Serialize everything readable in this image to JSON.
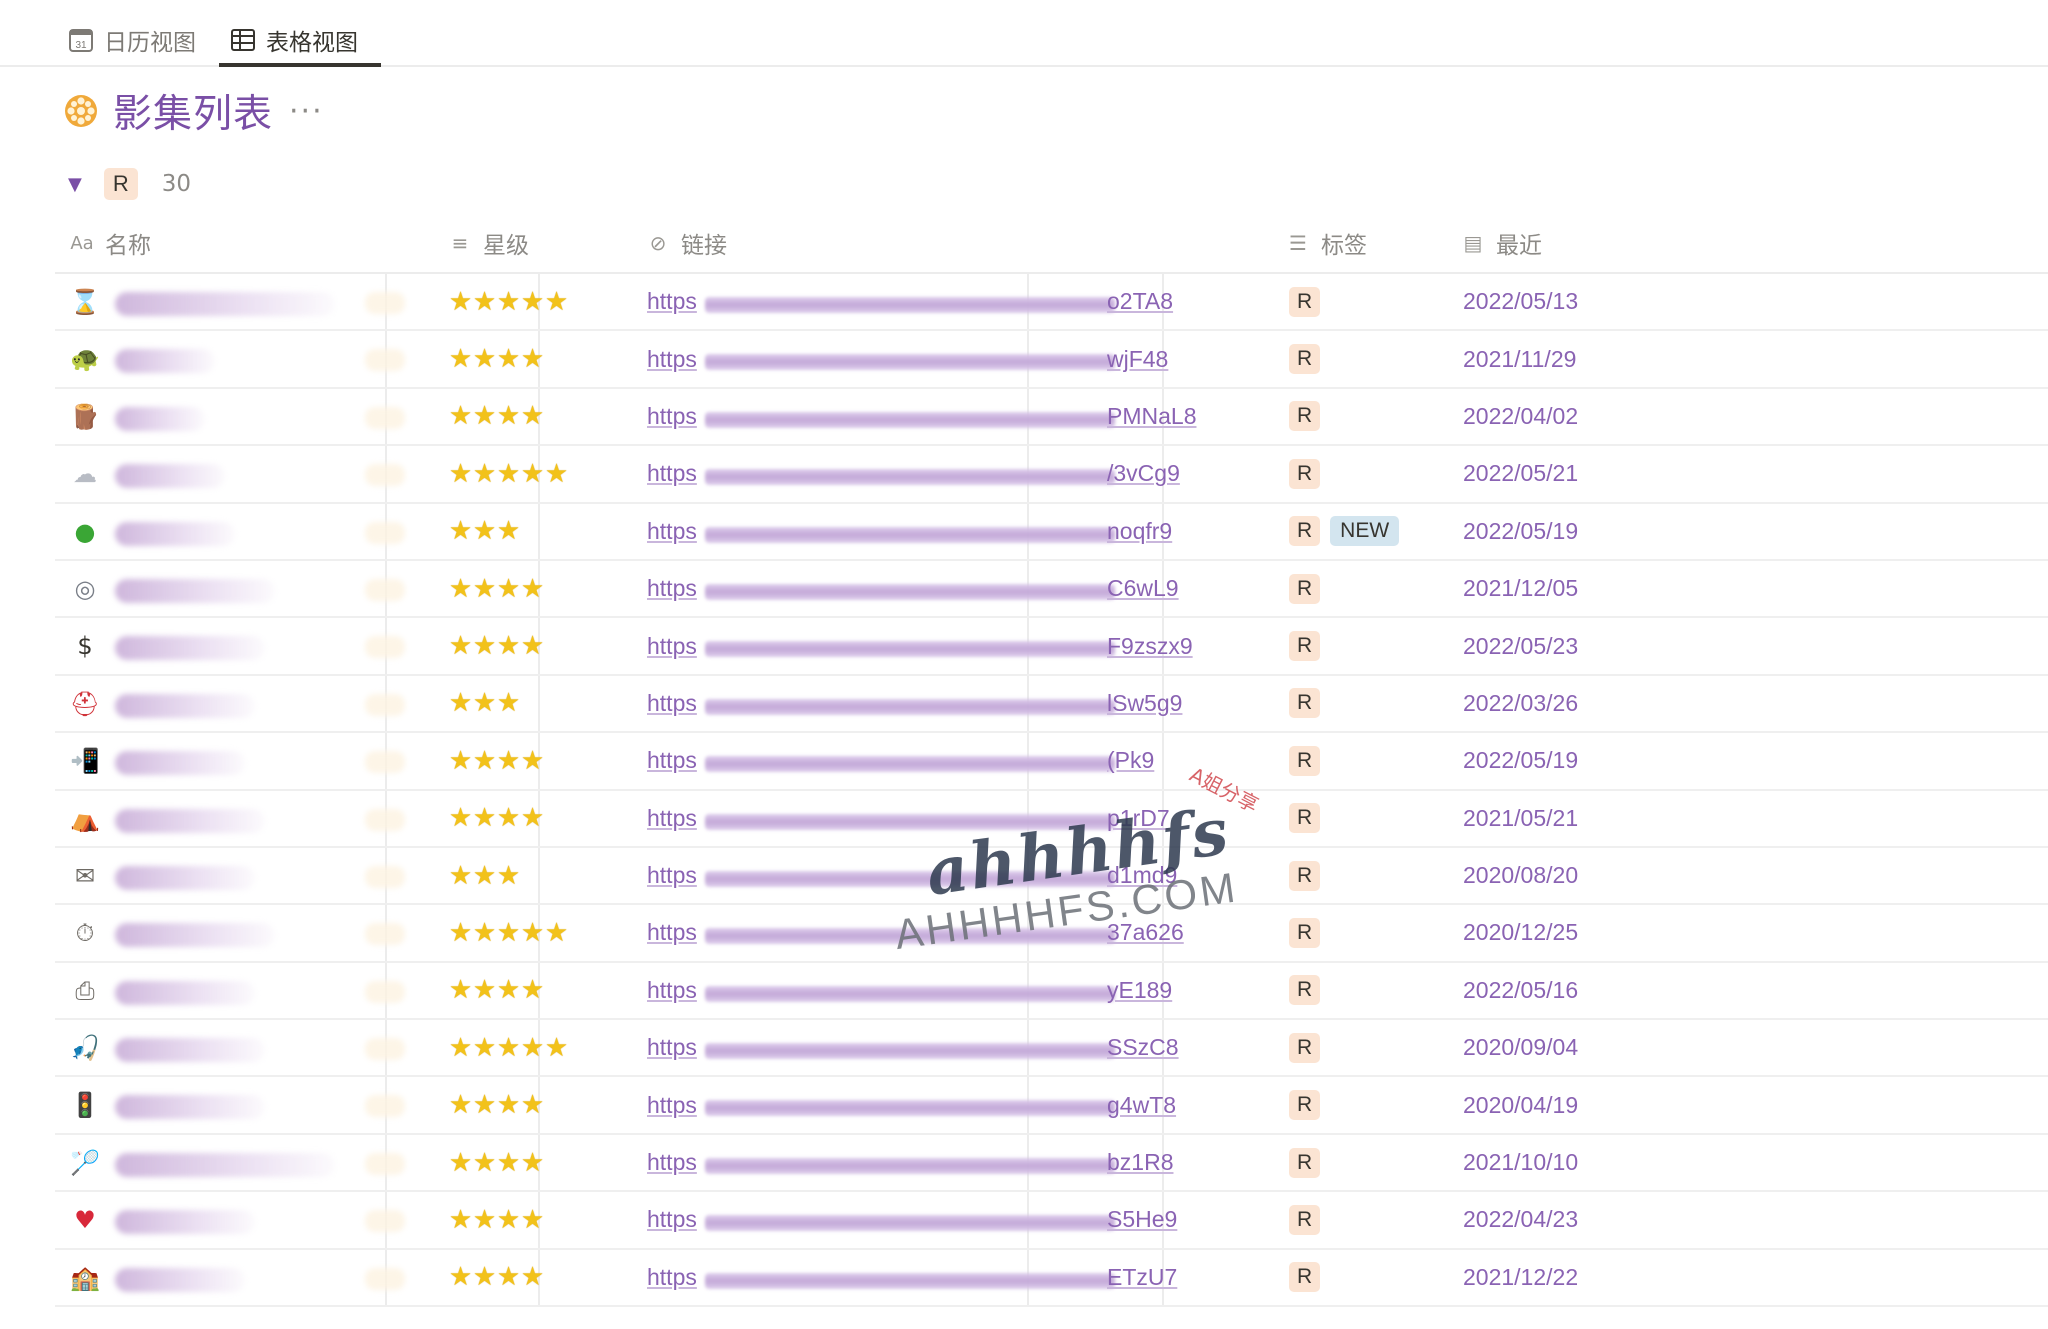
{
  "tabs": [
    {
      "label": "日历视图",
      "icon": "calendar-icon",
      "active": false
    },
    {
      "label": "表格视图",
      "icon": "table-icon",
      "active": true
    }
  ],
  "page": {
    "title": "影集列表",
    "emoji": "film-reel-icon",
    "more": "···"
  },
  "group": {
    "caret": "▼",
    "tag": "R",
    "count": "30"
  },
  "columns": {
    "name": {
      "label": "名称",
      "icon": "Aa"
    },
    "rating": {
      "label": "星级",
      "icon": "≡"
    },
    "link": {
      "label": "链接",
      "icon": "⊘"
    },
    "tags": {
      "label": "标签",
      "icon": "☰"
    },
    "recent": {
      "label": "最近",
      "icon": "▤"
    }
  },
  "rows": [
    {
      "emoji": "hourglass-icon",
      "stars": 5,
      "link_prefix": "https",
      "link_suffix": "o2TA8",
      "tags": [
        "R"
      ],
      "date": "2022/05/13"
    },
    {
      "emoji": "turtle-icon",
      "stars": 4,
      "link_prefix": "https",
      "link_suffix": "wjF48",
      "tags": [
        "R"
      ],
      "date": "2021/11/29"
    },
    {
      "emoji": "wood-icon",
      "stars": 4,
      "link_prefix": "https",
      "link_suffix": "PMNaL8",
      "tags": [
        "R"
      ],
      "date": "2022/04/02"
    },
    {
      "emoji": "cloud-icon",
      "stars": 5,
      "link_prefix": "https",
      "link_suffix": "/3vCg9",
      "tags": [
        "R"
      ],
      "date": "2022/05/21"
    },
    {
      "emoji": "green-ball-icon",
      "stars": 3,
      "link_prefix": "https",
      "link_suffix": "noqfr9",
      "tags": [
        "R",
        "NEW"
      ],
      "date": "2022/05/19"
    },
    {
      "emoji": "goggles-icon",
      "stars": 4,
      "link_prefix": "https",
      "link_suffix": "C6wL9",
      "tags": [
        "R"
      ],
      "date": "2021/12/05"
    },
    {
      "emoji": "dollar-icon",
      "stars": 4,
      "link_prefix": "https",
      "link_suffix": "F9zszx9",
      "tags": [
        "R"
      ],
      "date": "2022/05/23"
    },
    {
      "emoji": "helmet-icon",
      "stars": 3,
      "link_prefix": "https",
      "link_suffix": "lSw5g9",
      "tags": [
        "R"
      ],
      "date": "2022/03/26"
    },
    {
      "emoji": "phone-arrow-icon",
      "stars": 4,
      "link_prefix": "https",
      "link_suffix": "(Pk9",
      "tags": [
        "R"
      ],
      "date": "2022/05/19"
    },
    {
      "emoji": "tent-icon",
      "stars": 4,
      "link_prefix": "https",
      "link_suffix": "p1rD7",
      "tags": [
        "R"
      ],
      "date": "2021/05/21"
    },
    {
      "emoji": "envelope-icon",
      "stars": 3,
      "link_prefix": "https",
      "link_suffix": "d1md9",
      "tags": [
        "R"
      ],
      "date": "2020/08/20"
    },
    {
      "emoji": "stopwatch-icon",
      "stars": 5,
      "link_prefix": "https",
      "link_suffix": "37a626",
      "tags": [
        "R"
      ],
      "date": "2020/12/25"
    },
    {
      "emoji": "printer-icon",
      "stars": 4,
      "link_prefix": "https",
      "link_suffix": "yE189",
      "tags": [
        "R"
      ],
      "date": "2022/05/16"
    },
    {
      "emoji": "fishing-icon",
      "stars": 5,
      "link_prefix": "https",
      "link_suffix": "SSzC8",
      "tags": [
        "R"
      ],
      "date": "2020/09/04"
    },
    {
      "emoji": "traffic-light-icon",
      "stars": 4,
      "link_prefix": "https",
      "link_suffix": "g4wT8",
      "tags": [
        "R"
      ],
      "date": "2020/04/19"
    },
    {
      "emoji": "racket-icon",
      "stars": 4,
      "link_prefix": "https",
      "link_suffix": "bz1R8",
      "tags": [
        "R"
      ],
      "date": "2021/10/10"
    },
    {
      "emoji": "heart-icon",
      "stars": 4,
      "link_prefix": "https",
      "link_suffix": "S5He9",
      "tags": [
        "R"
      ],
      "date": "2022/04/23"
    },
    {
      "emoji": "school-icon",
      "stars": 4,
      "link_prefix": "https",
      "link_suffix": "ETzU7",
      "tags": [
        "R"
      ],
      "date": "2021/12/22"
    }
  ],
  "watermark": {
    "main": "ahhhhfs",
    "sub": "AHHHHFS.COM",
    "tag": "A姐分享"
  },
  "colors": {
    "accent_purple": "#8a63b3",
    "tag_r": "#fbe4d3",
    "tag_new": "#d3e5ef",
    "star": "#f2c21a"
  }
}
